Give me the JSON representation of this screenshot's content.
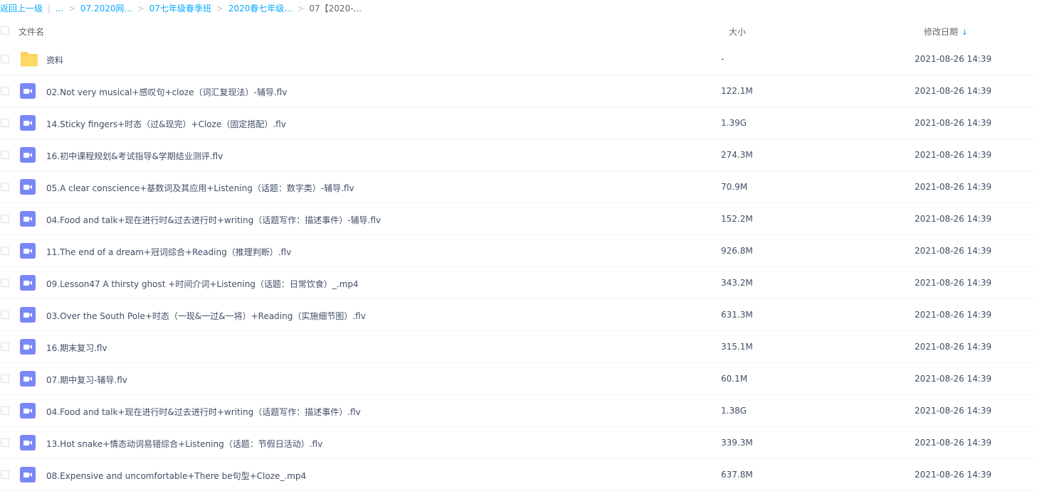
{
  "breadcrumb": {
    "back": "返回上一级",
    "divider": "|",
    "ellipsis": "...",
    "sep": ">",
    "items": [
      "07.2020网...",
      "07七年级春季班",
      "2020春七年级..."
    ],
    "current": "07【2020-..."
  },
  "header": {
    "name": "文件名",
    "size": "大小",
    "date": "修改日期",
    "sort_indicator": "↓"
  },
  "rows": [
    {
      "icon": "folder-icon",
      "name": "资料",
      "size": "-",
      "date": "2021-08-26 14:39"
    },
    {
      "icon": "video-file-icon",
      "name": "02.Not very musical+感叹句+cloze（词汇复现法）-辅导.flv",
      "size": "122.1M",
      "date": "2021-08-26 14:39"
    },
    {
      "icon": "video-file-icon",
      "name": "14.Sticky fingers+时态（过&现完）+Cloze（固定搭配）.flv",
      "size": "1.39G",
      "date": "2021-08-26 14:39"
    },
    {
      "icon": "video-file-icon",
      "name": "16.初中课程规划&考试指导&学期结业测评.flv",
      "size": "274.3M",
      "date": "2021-08-26 14:39"
    },
    {
      "icon": "video-file-icon",
      "name": "05.A clear conscience+基数词及其应用+Listening（话题：数字类）-辅导.flv",
      "size": "70.9M",
      "date": "2021-08-26 14:39"
    },
    {
      "icon": "video-file-icon",
      "name": "04.Food and talk+现在进行时&过去进行时+writing（话题写作：描述事件）-辅导.flv",
      "size": "152.2M",
      "date": "2021-08-26 14:39"
    },
    {
      "icon": "video-file-icon",
      "name": "11.The end of a dream+冠词综合+Reading（推理判断）.flv",
      "size": "926.8M",
      "date": "2021-08-26 14:39"
    },
    {
      "icon": "video-file-icon",
      "name": "09.Lesson47 A thirsty ghost +时间介词+Listening（话题：日常饮食）_.mp4",
      "size": "343.2M",
      "date": "2021-08-26 14:39"
    },
    {
      "icon": "video-file-icon",
      "name": "03.Over the South Pole+时态（一现&一过&一将）+Reading（实施细节图）.flv",
      "size": "631.3M",
      "date": "2021-08-26 14:39"
    },
    {
      "icon": "video-file-icon",
      "name": "16.期末复习.flv",
      "size": "315.1M",
      "date": "2021-08-26 14:39"
    },
    {
      "icon": "video-file-icon",
      "name": "07.期中复习-辅导.flv",
      "size": "60.1M",
      "date": "2021-08-26 14:39"
    },
    {
      "icon": "video-file-icon",
      "name": "04.Food and talk+现在进行时&过去进行时+writing（话题写作：描述事件）.flv",
      "size": "1.38G",
      "date": "2021-08-26 14:39"
    },
    {
      "icon": "video-file-icon",
      "name": "13.Hot snake+情态动词易错综合+Listening（话题：节假日活动）.flv",
      "size": "339.3M",
      "date": "2021-08-26 14:39"
    },
    {
      "icon": "video-file-icon",
      "name": "08.Expensive and uncomfortable+There be句型+Cloze_.mp4",
      "size": "637.8M",
      "date": "2021-08-26 14:39"
    }
  ]
}
